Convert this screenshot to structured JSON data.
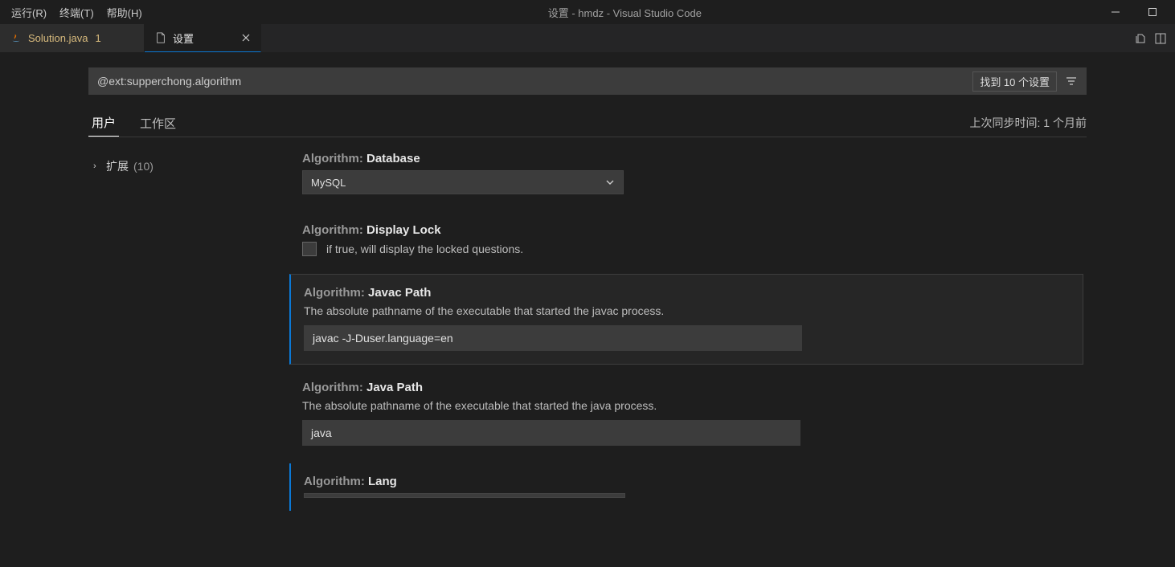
{
  "menubar": {
    "run": "运行(R)",
    "terminal": "终端(T)",
    "help": "帮助(H)"
  },
  "window": {
    "title": "设置 - hmdz - Visual Studio Code"
  },
  "tabs": {
    "file": {
      "label": "Solution.java",
      "dirty_badge": "1"
    },
    "settings": {
      "label": "设置"
    }
  },
  "search": {
    "value": "@ext:supperchong.algorithm",
    "found_label": "找到 10 个设置"
  },
  "scope": {
    "user": "用户",
    "workspace": "工作区",
    "sync_info": "上次同步时间: 1 个月前"
  },
  "tree": {
    "ext_label": "扩展",
    "ext_count": "(10)"
  },
  "settings": {
    "database": {
      "cat": "Algorithm: ",
      "key": "Database",
      "value": "MySQL"
    },
    "display_lock": {
      "cat": "Algorithm: ",
      "key": "Display Lock",
      "desc": "if true, will display the locked questions."
    },
    "javac_path": {
      "cat": "Algorithm: ",
      "key": "Javac Path",
      "desc": "The absolute pathname of the executable that started the javac process.",
      "value": "javac -J-Duser.language=en"
    },
    "java_path": {
      "cat": "Algorithm: ",
      "key": "Java Path",
      "desc": "The absolute pathname of the executable that started the java process.",
      "value": "java"
    },
    "lang": {
      "cat": "Algorithm: ",
      "key": "Lang"
    }
  }
}
